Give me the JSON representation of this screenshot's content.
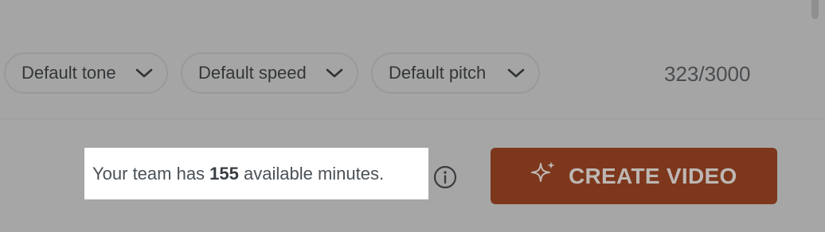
{
  "voice_options": {
    "tone_label": "Default tone",
    "speed_label": "Default speed",
    "pitch_label": "Default pitch"
  },
  "character_count": "323/3000",
  "minutes_notice": {
    "prefix": "Your team has ",
    "minutes": "155",
    "suffix": " available minutes."
  },
  "create_button": {
    "label": "CREATE VIDEO",
    "icon": "sparkle-icon"
  },
  "icons": {
    "dropdown": "chevron-down-icon",
    "info": "info-icon"
  },
  "colors": {
    "create_button_bg": "#7d371d",
    "create_button_text": "#bdb7b3",
    "overlay_bg": "#a6a6a6",
    "highlight_bg": "#ffffff"
  }
}
